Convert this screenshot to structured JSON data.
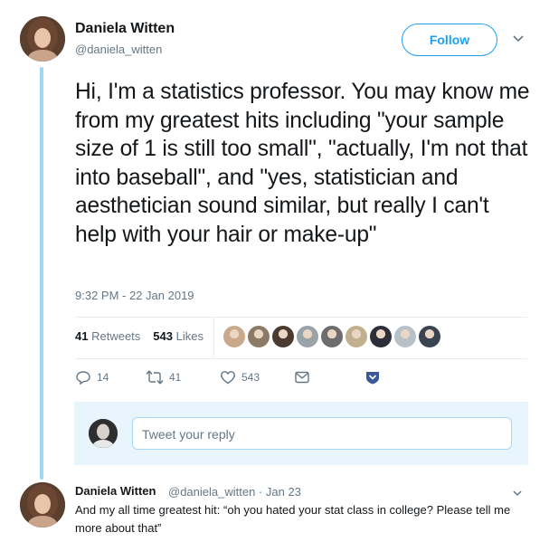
{
  "tweet": {
    "author_name": "Daniela Witten",
    "author_handle": "@daniela_witten",
    "follow_label": "Follow",
    "text": "Hi, I'm a statistics professor. You may know me from my greatest hits including \"your sample size of 1 is still too small\", \"actually, I'm not that into baseball\", and \"yes, statistician and aesthetician sound similar, but really I can't help with your hair or make-up\"",
    "timestamp": "9:32 PM - 22 Jan 2019",
    "retweets_count": "41",
    "retweets_label": "Retweets",
    "likes_count": "543",
    "likes_label": "Likes",
    "liker_avatar_colors": [
      "#c9a98a",
      "#8b7a66",
      "#4a3a30",
      "#9aa4a8",
      "#6d6d6d",
      "#c0b090",
      "#2e2e3a",
      "#b8c0c8",
      "#3a4450"
    ]
  },
  "actions": {
    "reply_count": "14",
    "retweet_count": "41",
    "like_count": "543",
    "icons": [
      "reply-icon",
      "retweet-icon",
      "like-icon",
      "message-icon",
      "shield-icon"
    ]
  },
  "reply_box": {
    "placeholder": "Tweet your reply"
  },
  "reply_tweet": {
    "author_name": "Daniela Witten",
    "meta": "@daniela_witten · Jan 23",
    "text": "And my all time greatest hit: “oh you hated your stat class in college? Please tell me more about that”"
  },
  "colors": {
    "accent": "#1da1f2",
    "thread_line": "#9fd8f5",
    "muted_text": "#657786",
    "shield": "#3b5998"
  }
}
